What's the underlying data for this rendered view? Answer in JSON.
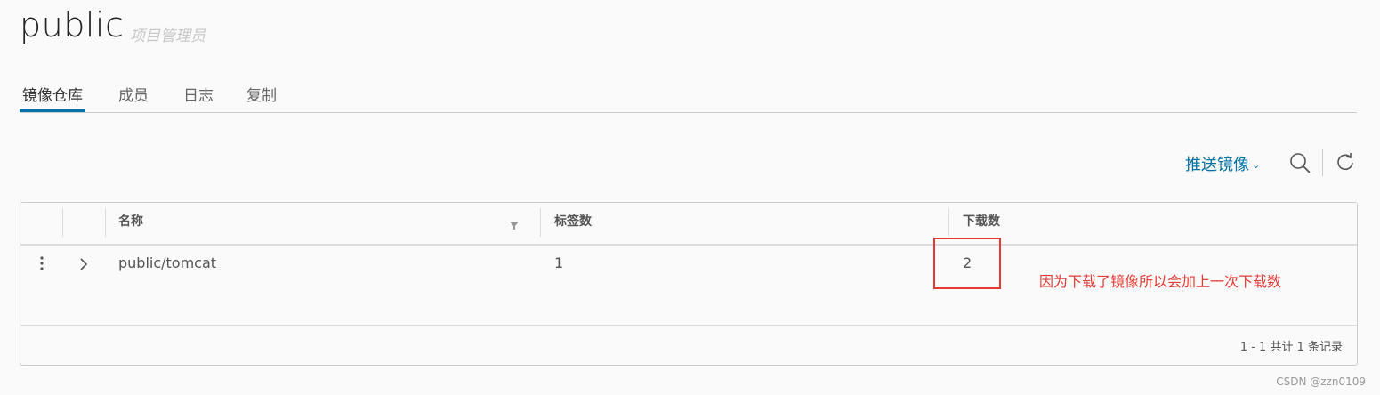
{
  "project": {
    "name": "public",
    "role": "项目管理员"
  },
  "tabs": [
    {
      "label": "镜像仓库",
      "active": true
    },
    {
      "label": "成员",
      "active": false
    },
    {
      "label": "日志",
      "active": false
    },
    {
      "label": "复制",
      "active": false
    }
  ],
  "toolbar": {
    "push_image_label": "推送镜像",
    "push_image_caret": "⌄",
    "icons": [
      "search-icon",
      "refresh-icon"
    ]
  },
  "table": {
    "columns": [
      "名称",
      "标签数",
      "下载数"
    ],
    "rows": [
      {
        "name": "public/tomcat",
        "tags": "1",
        "downloads": "2"
      }
    ],
    "footer": "1 - 1 共计 1 条记录"
  },
  "annotation": "因为下载了镜像所以会加上一次下载数",
  "watermark": "CSDN @zzn0109",
  "colors": {
    "accent": "#0072a3",
    "annotation_red": "#e53935"
  }
}
